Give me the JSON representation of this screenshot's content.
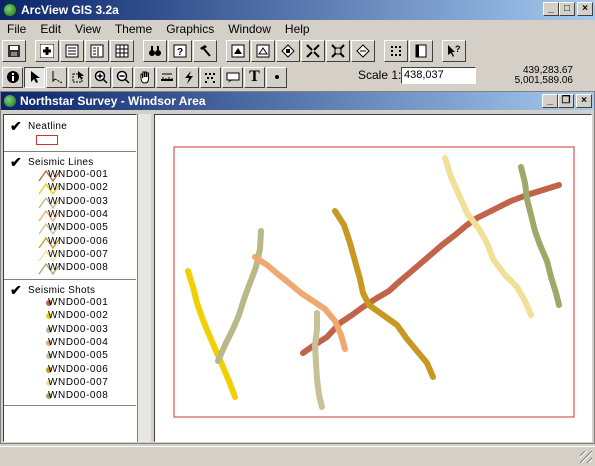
{
  "app": {
    "title": "ArcView GIS 3.2a"
  },
  "menu": [
    "File",
    "Edit",
    "View",
    "Theme",
    "Graphics",
    "Window",
    "Help"
  ],
  "toolbar": {
    "buttons": [
      "save",
      "add-theme",
      "theme-properties",
      "edit-legend",
      "open-table",
      "find",
      "query",
      "hotlink",
      "zoom-full",
      "zoom-active",
      "zoom-selected",
      "zoom-in-fixed",
      "zoom-out-fixed",
      "zoom-previous",
      "select-all",
      "layout",
      "help-pointer"
    ]
  },
  "tools": {
    "icons": [
      "identify",
      "pointer",
      "vertex-edit",
      "select-feature",
      "zoom-in",
      "zoom-out",
      "pan",
      "measure",
      "hotlink-tool",
      "label",
      "area-label",
      "text",
      "draw-point"
    ],
    "text_tool_glyph": "T"
  },
  "scale": {
    "label": "Scale 1:",
    "value": "438,037"
  },
  "coords": {
    "x": "439,283.67",
    "y": "5,001,589.06"
  },
  "view": {
    "title": "Northstar Survey - Windsor Area"
  },
  "legend": {
    "neatline": {
      "name": "Neatline",
      "color": "#cc3333"
    },
    "lines_theme": "Seismic Lines",
    "shots_theme": "Seismic Shots",
    "lines": [
      {
        "label": "WND00-001",
        "color": "#c0644a"
      },
      {
        "label": "WND00-002",
        "color": "#f0d000"
      },
      {
        "label": "WND00-003",
        "color": "#b8b888"
      },
      {
        "label": "WND00-004",
        "color": "#f0a870"
      },
      {
        "label": "WND00-005",
        "color": "#c8c098"
      },
      {
        "label": "WND00-006",
        "color": "#c89820"
      },
      {
        "label": "WND00-007",
        "color": "#f0e098"
      },
      {
        "label": "WND00-008",
        "color": "#a0a868"
      }
    ],
    "shots": [
      {
        "label": "WND00-001",
        "color": "#c0644a"
      },
      {
        "label": "WND00-002",
        "color": "#f0d000"
      },
      {
        "label": "WND00-003",
        "color": "#b8b888"
      },
      {
        "label": "WND00-004",
        "color": "#f0a870"
      },
      {
        "label": "WND00-005",
        "color": "#c8c098"
      },
      {
        "label": "WND00-006",
        "color": "#c89820"
      },
      {
        "label": "WND00-007",
        "color": "#f0e098"
      },
      {
        "label": "WND00-008",
        "color": "#a0a868"
      }
    ]
  }
}
